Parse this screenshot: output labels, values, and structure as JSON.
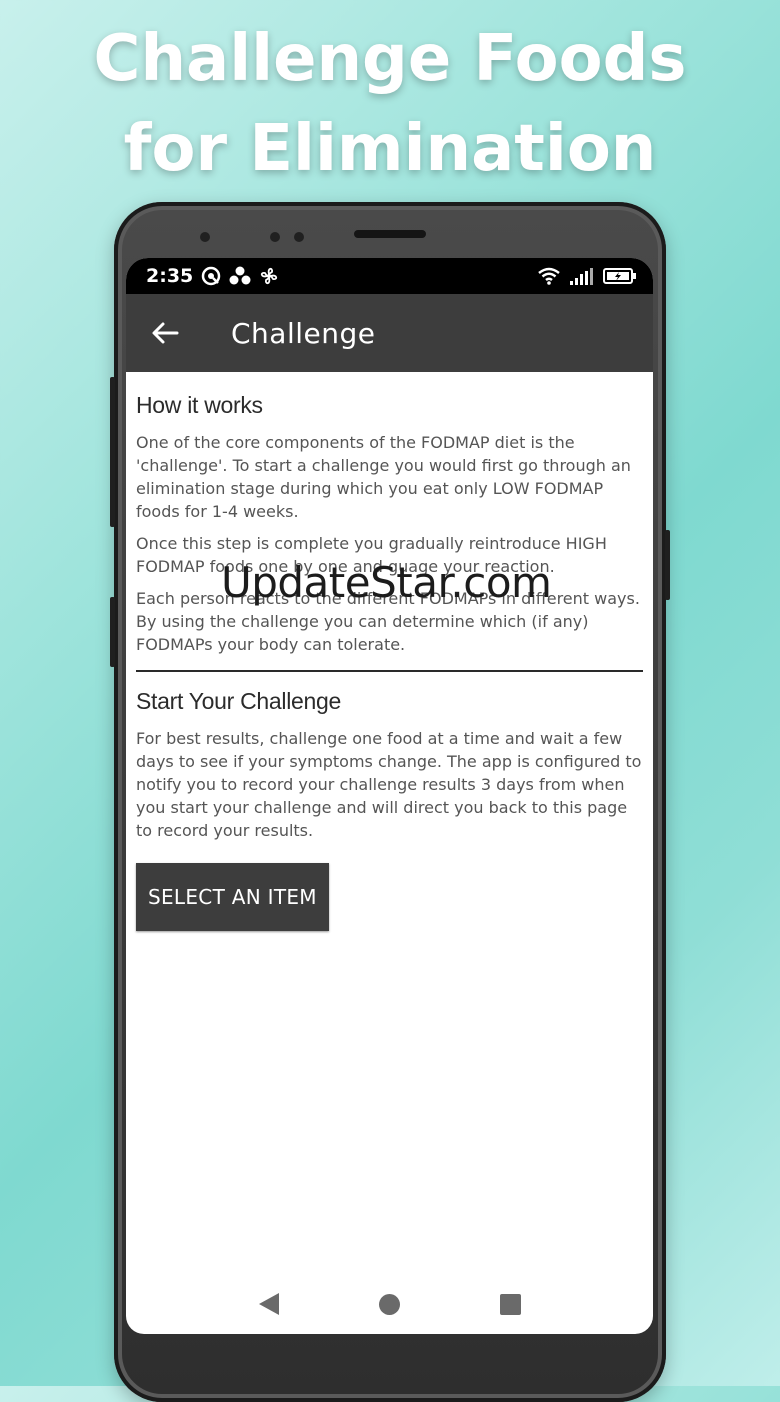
{
  "promo": {
    "title_line1": "Challenge Foods",
    "title_line2": "for Elimination"
  },
  "status_bar": {
    "time": "2:35",
    "left_icons": [
      "vpn-icon",
      "apps-icon",
      "fan-icon"
    ],
    "right_icons": [
      "wifi-icon",
      "signal-icon",
      "battery-icon"
    ]
  },
  "app_bar": {
    "title": "Challenge",
    "back_icon": "arrow-left-icon"
  },
  "how_it_works": {
    "heading": "How it works",
    "paragraphs": [
      "One of the core components of the FODMAP diet is the 'challenge'. To start a challenge you would first go through an elimination stage during which you eat only LOW FODMAP foods for 1-4 weeks.",
      "Once this step is complete you gradually reintroduce HIGH FODMAP foods one by one and guage your reaction.",
      "Each person reacts to the different FODMAPs in different ways. By using the challenge you can determine which (if any) FODMAPs your body can tolerate."
    ]
  },
  "start_challenge": {
    "heading": "Start Your Challenge",
    "paragraph": "For best results, challenge one food at a time and wait a few days to see if your symptoms change. The app is configured to notify you to record your challenge results 3 days from when you start your challenge and will direct you back to this page to record your results.",
    "button_label": "SELECT AN ITEM"
  },
  "watermark": "UpdateStar.com",
  "nav_bar": {
    "icons": [
      "nav-back-icon",
      "nav-home-icon",
      "nav-recents-icon"
    ]
  },
  "colors": {
    "app_bar": "#3d3d3d",
    "button": "#3d3d3d",
    "background_accent": "#7fd9d0"
  }
}
